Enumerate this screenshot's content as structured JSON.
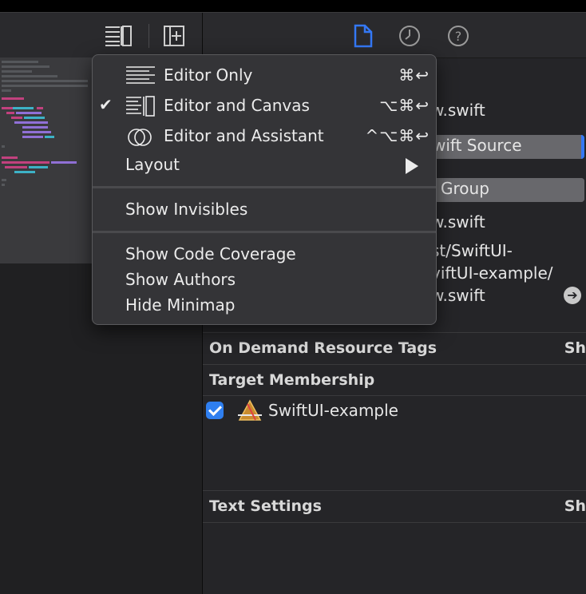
{
  "inspector": {
    "fields": {
      "filename_partial": "w.swift",
      "type_partial": "wift Source",
      "location_partial": "Group",
      "name_partial": "w.swift",
      "path_line1": "st/SwiftUI-",
      "path_line2": "viftUI-example/",
      "path_line3": "w.swift"
    },
    "sections": [
      {
        "title": "On Demand Resource Tags",
        "right": "Sh"
      },
      {
        "title": "Target Membership",
        "right": ""
      },
      {
        "title": "Text Settings",
        "right": "Sh"
      }
    ],
    "target_membership": {
      "label": "SwiftUI-example",
      "checked": true
    }
  },
  "menu": {
    "items": [
      {
        "label": "Editor Only",
        "shortcut": "⌘↩",
        "checked": false,
        "icon": "editor-only-icon"
      },
      {
        "label": "Editor and Canvas",
        "shortcut": "⌥⌘↩",
        "checked": true,
        "check_glyph": "✔",
        "icon": "editor-canvas-icon"
      },
      {
        "label": "Editor and Assistant",
        "shortcut": "^⌥⌘↩",
        "checked": false,
        "icon": "assistant-icon"
      },
      {
        "label": "Layout",
        "submenu": true
      },
      {
        "label": "Show Invisibles"
      },
      {
        "label": "Show Code Coverage"
      },
      {
        "label": "Show Authors"
      },
      {
        "label": "Hide Minimap"
      }
    ]
  },
  "colors": {
    "accent": "#3478f6",
    "menu_bg": "#343437",
    "inspector_bg": "#252528"
  }
}
